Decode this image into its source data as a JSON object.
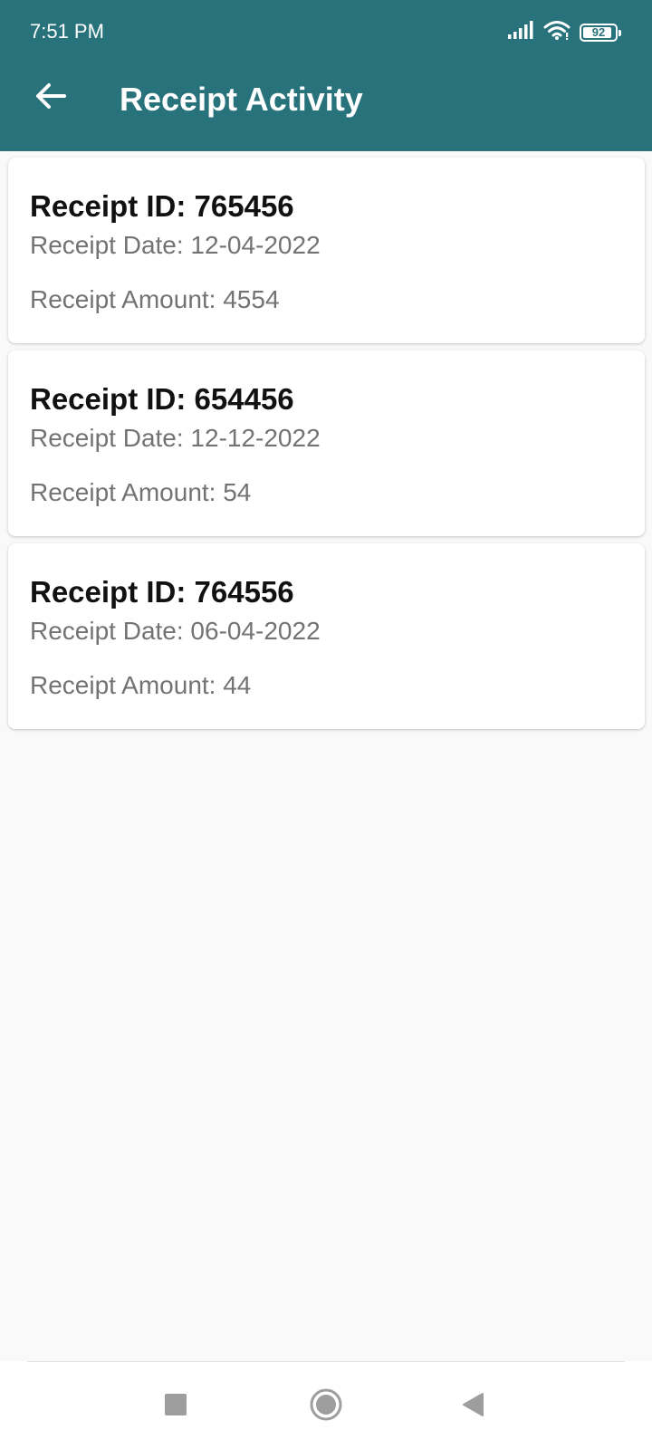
{
  "status_bar": {
    "time": "7:51 PM",
    "battery": "92",
    "battery_level": 0.92,
    "icons": [
      "signal-icon",
      "wifi-icon",
      "battery-icon"
    ]
  },
  "app_bar": {
    "title": "Receipt Activity",
    "back_icon": "arrow-left-icon",
    "color": "#27727b"
  },
  "receipts": [
    {
      "id": "Receipt ID: 765456",
      "date": "Receipt Date: 12-04-2022",
      "amount": "Receipt Amount: 4554"
    },
    {
      "id": "Receipt ID: 654456",
      "date": "Receipt Date: 12-12-2022",
      "amount": "Receipt Amount: 54"
    },
    {
      "id": "Receipt ID: 764556",
      "date": "Receipt Date: 06-04-2022",
      "amount": "Receipt Amount: 44"
    }
  ],
  "nav_bar": {
    "icons": [
      "recents-square-icon",
      "home-circle-icon",
      "back-triangle-icon"
    ]
  }
}
